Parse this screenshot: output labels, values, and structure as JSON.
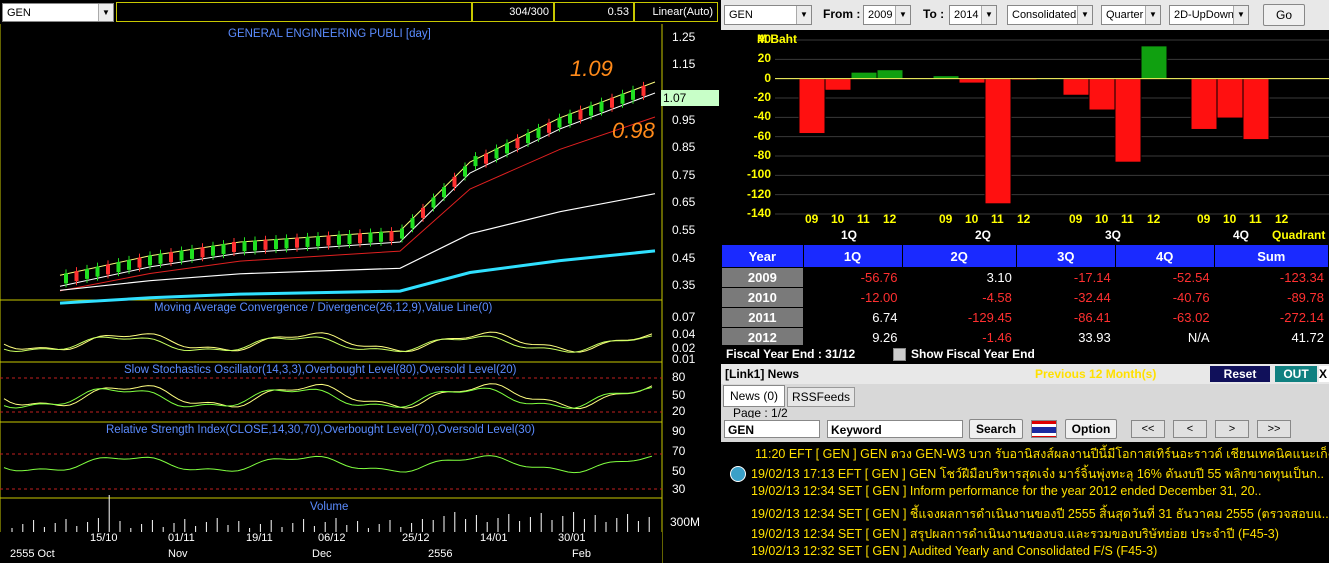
{
  "left": {
    "symbol": "GEN",
    "counter": "304/300",
    "value": "0.53",
    "scale": "Linear(Auto)",
    "main_title": "GENERAL ENGINEERING PUBLI [day]",
    "price_hi": "1.09",
    "price_lo": "0.98",
    "last_price": "1.07",
    "price_ticks": [
      "1.25",
      "1.15",
      "0.95",
      "0.85",
      "0.75",
      "0.65",
      "0.55",
      "0.45",
      "0.35"
    ],
    "macd_title": "Moving Average Convergence / Divergence(26,12,9),Value Line(0)",
    "macd_ticks": [
      "0.07",
      "0.04",
      "0.02",
      "0.01"
    ],
    "stoch_title": "Slow Stochastics Oscillator(14,3,3),Overbought Level(80),Oversold Level(20)",
    "stoch_ticks": [
      "80",
      "50",
      "20"
    ],
    "rsi_title": "Relative Strength Index(CLOSE,14,30,70),Overbought Level(70),Oversold Level(30)",
    "rsi_ticks": [
      "90",
      "70",
      "50",
      "30"
    ],
    "vol_title": "Volume",
    "vol_tick": "300M",
    "date_labels": [
      "15/10",
      "01/11",
      "19/11",
      "06/12",
      "25/12",
      "14/01",
      "30/01"
    ],
    "month_labels": [
      "2555 Oct",
      "Nov",
      "Dec",
      "2556",
      "Feb"
    ]
  },
  "right": {
    "symbol": "GEN",
    "from_label": "From :",
    "from_value": "2009",
    "to_label": "To :",
    "to_value": "2014",
    "mode": "Consolidated",
    "period": "Quarter",
    "view": "2D-UpDown",
    "go": "Go",
    "chart_unit": "M Baht",
    "quadrant": "Quadrant",
    "quarters": [
      "1Q",
      "2Q",
      "3Q",
      "4Q"
    ],
    "years_short": [
      "09",
      "10",
      "11",
      "12"
    ],
    "y_ticks": [
      "40",
      "20",
      "0",
      "-20",
      "-40",
      "-60",
      "-80",
      "-100",
      "-120",
      "-140"
    ],
    "table": {
      "headers": [
        "Year",
        "1Q",
        "2Q",
        "3Q",
        "4Q",
        "Sum"
      ],
      "rows": [
        [
          "2009",
          "-56.76",
          "3.10",
          "-17.14",
          "-52.54",
          "-123.34"
        ],
        [
          "2010",
          "-12.00",
          "-4.58",
          "-32.44",
          "-40.76",
          "-89.78"
        ],
        [
          "2011",
          "6.74",
          "-129.45",
          "-86.41",
          "-63.02",
          "-272.14"
        ],
        [
          "2012",
          "9.26",
          "-1.46",
          "33.93",
          "N/A",
          "41.72"
        ]
      ]
    },
    "fiscal_label": "Fiscal  Year  End  :  31/12",
    "show_fiscal": "Show Fiscal Year End",
    "news_title": "[Link1] News",
    "news_period": "Previous 12 Month(s)",
    "reset": "Reset",
    "out": "OUT",
    "close_x": "X",
    "tab_news": "News (0)",
    "tab_rss": "RSSFeeds",
    "page": "Page : 1/2",
    "filter_symbol": "GEN",
    "keyword_placeholder": "Keyword",
    "search": "Search",
    "option": "Option",
    "nav": [
      "<<",
      "<",
      ">",
      ">>"
    ],
    "news": [
      "11:20  EFT  [ GEN ]  GEN ดวง GEN-W3 บวก รับอานิสงส์ผลงานปีนี้มีโอกาสเทิร์นอะราวด์ เชียนเทคนิคแนะเก็ง..",
      "19/02/13 17:13  EFT  [ GEN ]  GEN โชว์ฝีมือบริหารสุดเจ๋ง มาร์จิ้นพุ่งทะลุ 16% ดันงบปี 55 พลิกขาดทุนเป็นก..",
      "19/02/13 12:34  SET  [ GEN ]  Inform performance for the year 2012 ended December 31, 20..",
      "19/02/13 12:34  SET  [ GEN ]  ชี้แจงผลการดำเนินงานของปี 2555 สิ้นสุดวันที่ 31 ธันวาคม 2555 (ตรวจสอบแ..",
      "19/02/13 12:34  SET  [ GEN ]  สรุปผลการดำเนินงานของบจ.และรวมของบริษัทย่อย ประจำปี (F45-3)",
      "19/02/13 12:32  SET  [ GEN ]  Audited Yearly and Consolidated F/S (F45-3)"
    ]
  },
  "chart_data": [
    {
      "type": "line",
      "title": "GENERAL ENGINEERING PUBLI [day]",
      "x": [
        "15/10",
        "01/11",
        "19/11",
        "06/12",
        "25/12",
        "14/01",
        "30/01",
        "Feb"
      ],
      "series": [
        {
          "name": "",
          "values": [
            0.37,
            0.44,
            0.49,
            0.51,
            0.53,
            0.78,
            0.94,
            1.07
          ]
        }
      ],
      "ylim": [
        0.3,
        1.3
      ]
    },
    {
      "type": "bar",
      "title": "M Baht",
      "categories": [
        "1Q-09",
        "1Q-10",
        "1Q-11",
        "1Q-12",
        "2Q-09",
        "2Q-10",
        "2Q-11",
        "2Q-12",
        "3Q-09",
        "3Q-10",
        "3Q-11",
        "3Q-12",
        "4Q-09",
        "4Q-10",
        "4Q-11",
        "4Q-12"
      ],
      "values": [
        -56.76,
        -12.0,
        6.74,
        9.26,
        3.1,
        -4.58,
        -129.45,
        -1.46,
        -17.14,
        -32.44,
        -86.41,
        33.93,
        -52.54,
        -40.76,
        -63.02,
        null
      ],
      "ylim": [
        -140,
        40
      ]
    }
  ]
}
